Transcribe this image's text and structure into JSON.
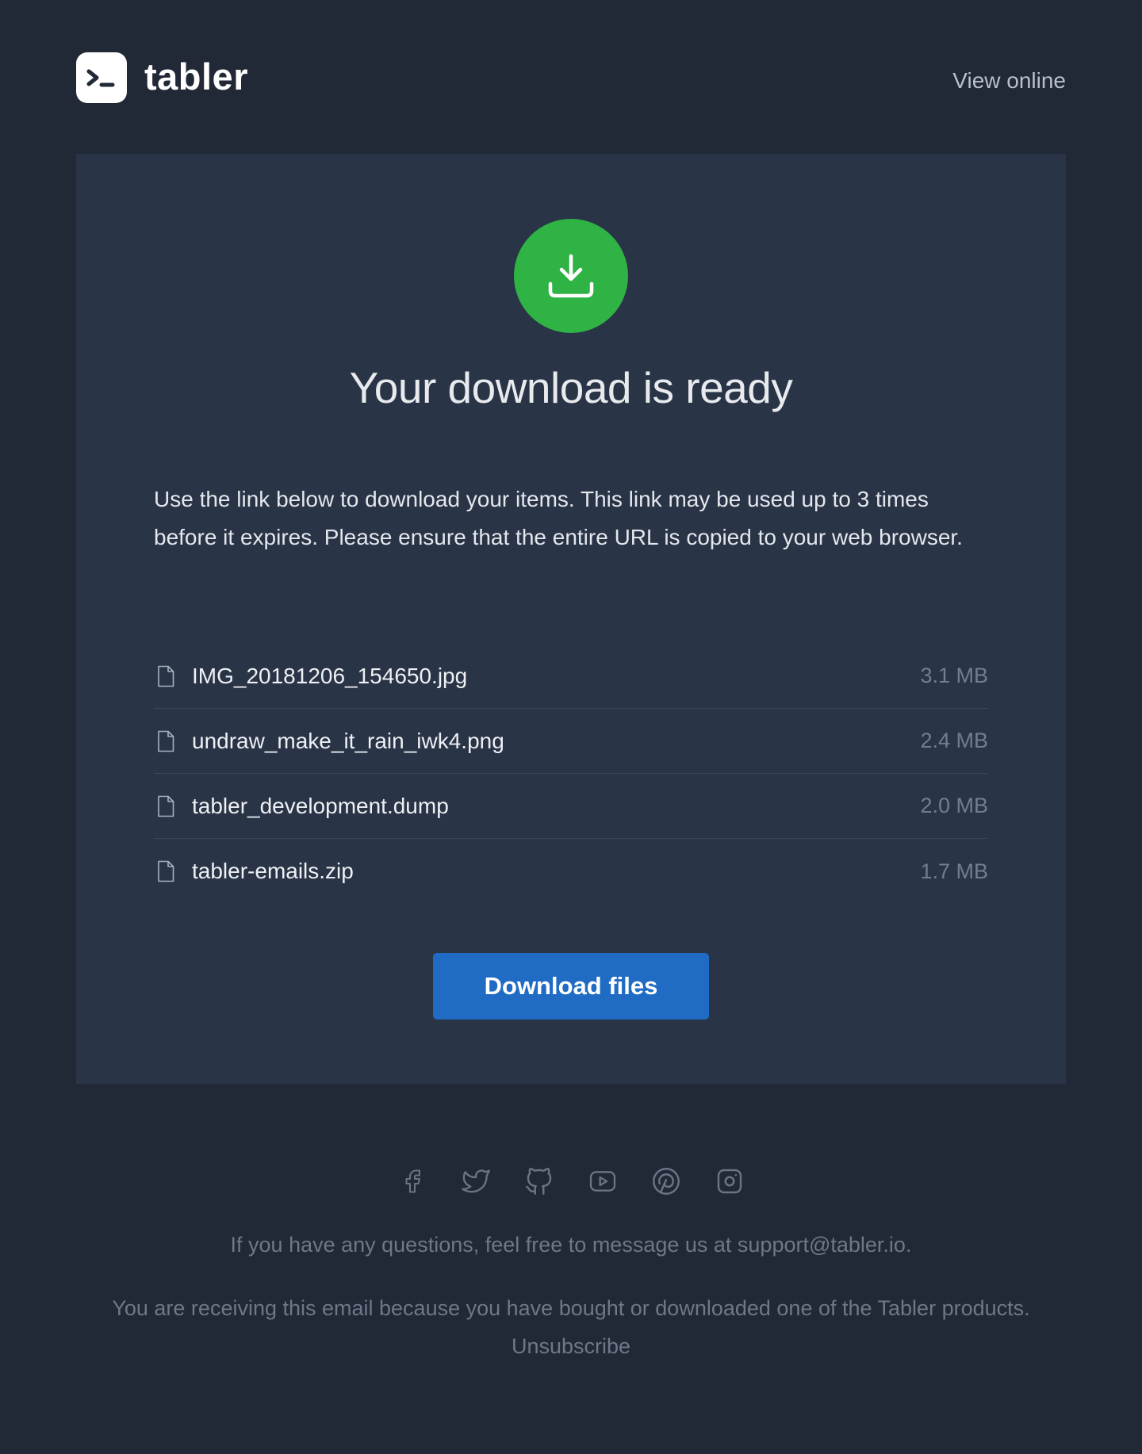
{
  "header": {
    "brand_name": "tabler",
    "view_online_label": "View online"
  },
  "card": {
    "hero_icon": "download-icon",
    "title": "Your download is ready",
    "intro": "Use the link below to download your items. This link may be used up to 3 times before it expires. Please ensure that the entire URL is copied to your web browser.",
    "files": [
      {
        "name": "IMG_20181206_154650.jpg",
        "size": "3.1 MB"
      },
      {
        "name": "undraw_make_it_rain_iwk4.png",
        "size": "2.4 MB"
      },
      {
        "name": "tabler_development.dump",
        "size": "2.0 MB"
      },
      {
        "name": "tabler-emails.zip",
        "size": "1.7 MB"
      }
    ],
    "download_button_label": "Download files"
  },
  "footer": {
    "social_icons": [
      "facebook-icon",
      "twitter-icon",
      "github-icon",
      "youtube-icon",
      "pinterest-icon",
      "instagram-icon"
    ],
    "questions_text": "If you have any questions, feel free to message us at support@tabler.io.",
    "receiving_text": "You are receiving this email because you have bought or downloaded one of the Tabler products.",
    "unsubscribe_label": "Unsubscribe"
  },
  "colors": {
    "page_background": "#212836",
    "card_background": "#293447",
    "success_green": "#2fb344",
    "primary_blue": "#206bc4",
    "muted_text": "#6e7888"
  }
}
